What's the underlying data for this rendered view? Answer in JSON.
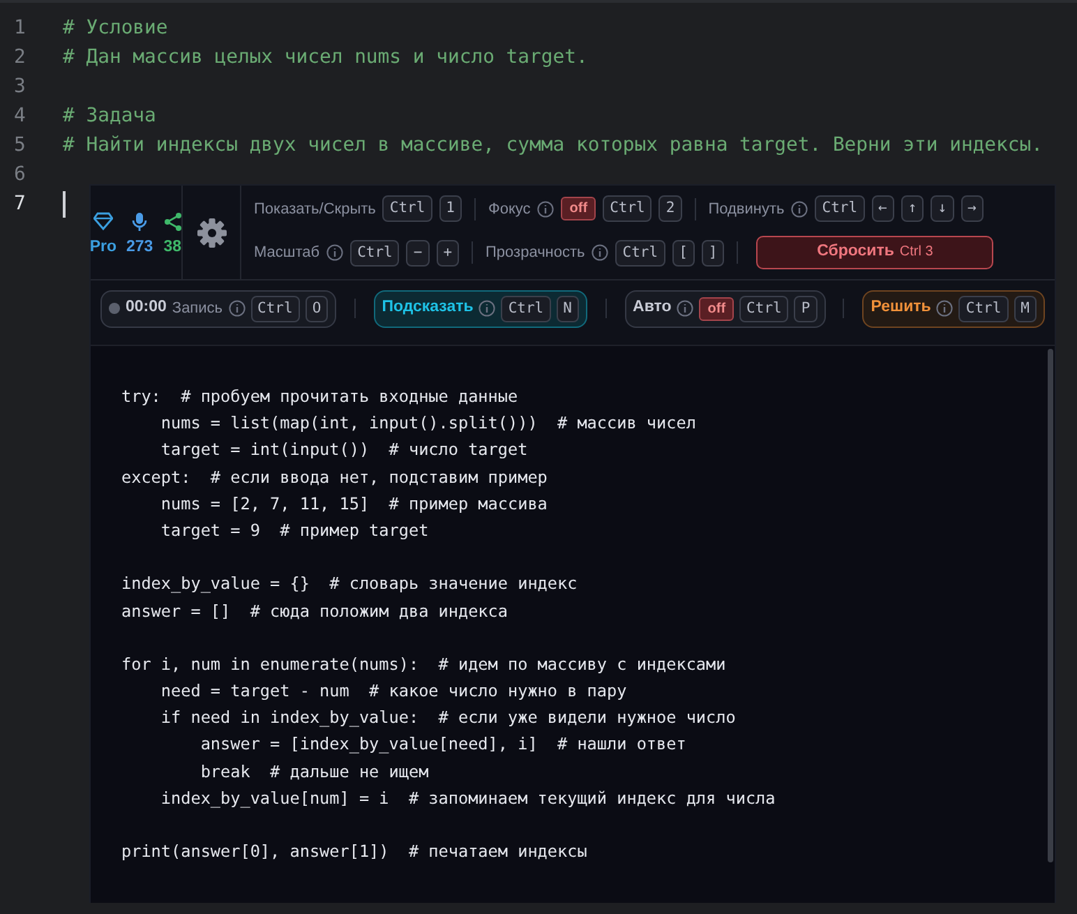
{
  "editor": {
    "lines": [
      {
        "number": "1",
        "cursor": false,
        "text": "# Условие"
      },
      {
        "number": "2",
        "cursor": false,
        "text": "# Дан массив целых чисел nums и число target."
      },
      {
        "number": "3",
        "cursor": false
      },
      {
        "number": "4",
        "cursor": false,
        "text": "# Задача"
      },
      {
        "number": "5",
        "cursor": false,
        "text": "# Найти индексы двух чисел в массиве, сумма которых равна target. Верни эти индексы."
      },
      {
        "number": "6",
        "cursor": false
      },
      {
        "number": "7",
        "cursor": true
      }
    ]
  },
  "overlay": {
    "stats": [
      {
        "kind": "plan",
        "value": "Pro"
      },
      {
        "kind": "mic",
        "value": "273"
      },
      {
        "kind": "share",
        "value": "38"
      }
    ],
    "shortcut_rows": [
      [
        {
          "label": "Показать/Скрыть",
          "info": false,
          "keys": [
            "Ctrl",
            "1"
          ]
        },
        {
          "label": "Фокус",
          "info": true,
          "toggle": "off",
          "keys": [
            "Ctrl",
            "2"
          ]
        },
        {
          "label": "Подвинуть",
          "info": true,
          "keys": [
            "Ctrl",
            "←",
            "↑",
            "↓",
            "→"
          ]
        }
      ],
      [
        {
          "label": "Масштаб",
          "info": true,
          "keys": [
            "Ctrl",
            "−",
            "+"
          ]
        },
        {
          "label": "Прозрачность",
          "info": true,
          "keys": [
            "Ctrl",
            "[",
            "]"
          ]
        }
      ]
    ],
    "reset_button": {
      "label": "Сбросить",
      "shortcut": "Ctrl 3"
    },
    "actions": [
      {
        "kind": "record",
        "time": "00:00",
        "label": "Запись",
        "keys": [
          "Ctrl",
          "O"
        ]
      },
      {
        "kind": "hint",
        "label": "Подсказать",
        "keys": [
          "Ctrl",
          "N"
        ]
      },
      {
        "kind": "auto",
        "label": "Авто",
        "toggle": "off",
        "keys": [
          "Ctrl",
          "P"
        ]
      },
      {
        "kind": "solve",
        "label": "Решить",
        "keys": [
          "Ctrl",
          "M"
        ]
      }
    ],
    "code_blocks": [
      [
        "try:  # пробуем прочитать входные данные",
        "    nums = list(map(int, input().split()))  # массив чисел",
        "    target = int(input())  # число target",
        "except:  # если ввода нет, подставим пример",
        "    nums = [2, 7, 11, 15]  # пример массива",
        "    target = 9  # пример target"
      ],
      [
        "index_by_value = {}  # словарь значение индекс",
        "answer = []  # сюда положим два индекса"
      ],
      [
        "for i, num in enumerate(nums):  # идем по массиву с индексами",
        "    need = target - num  # какое число нужно в пару",
        "    if need in index_by_value:  # если уже видели нужное число",
        "        answer = [index_by_value[need], i]  # нашли ответ",
        "        break  # дальше не ищем",
        "    index_by_value[num] = i  # запоминаем текущий индекс для числа"
      ],
      [
        "print(answer[0], answer[1])  # печатаем индексы"
      ]
    ]
  }
}
